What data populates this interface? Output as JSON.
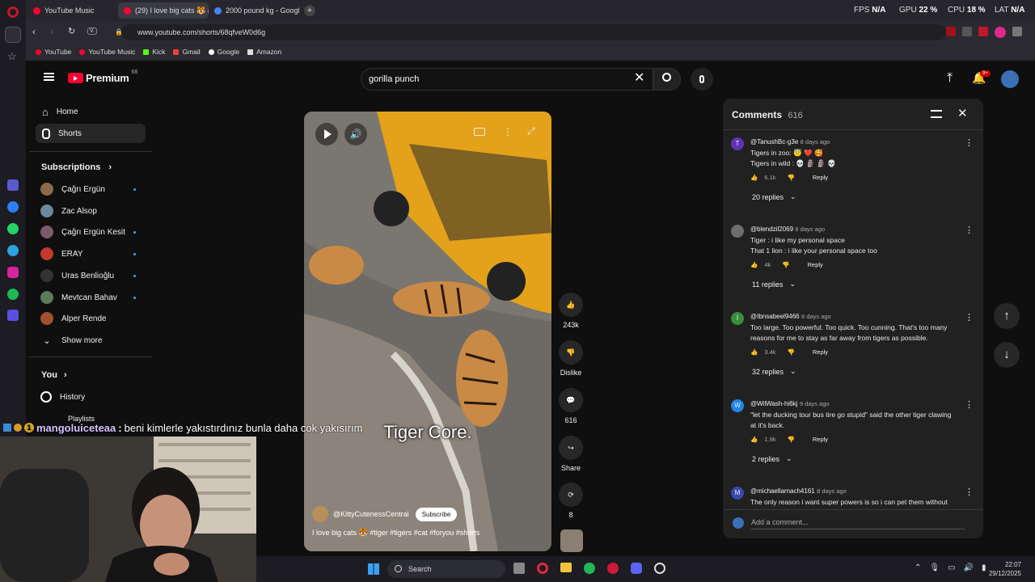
{
  "browser": {
    "tabs": [
      {
        "title": "YouTube Music",
        "color": "#ff0033"
      },
      {
        "title": "(29) I love big cats 🐯 #ti",
        "color": "#ff0033"
      },
      {
        "title": "2000 pound kg - Google'd",
        "color": "#4285f4"
      }
    ],
    "url_prefix": "V.",
    "url": "www.youtube.com/shorts/68qfveW0d6g",
    "bookmarks": [
      "YouTube",
      "YouTube Music",
      "Kick",
      "Gmail",
      "Google",
      "Amazon"
    ],
    "stats": {
      "fps_label": "FPS",
      "fps_value": "N/A",
      "gpu_label": "GPU",
      "gpu_value": "22 %",
      "cpu_label": "CPU",
      "cpu_value": "18 %",
      "lat_label": "LAT",
      "lat_value": "N/A"
    }
  },
  "yt": {
    "logo_text": "Premium",
    "logo_sup": "68",
    "search_value": "gorilla punch",
    "notif_badge": "9+",
    "sidebar": {
      "home": "Home",
      "shorts": "Shorts",
      "subscriptions_header": "Subscriptions",
      "subs": [
        {
          "name": "Çağrı Ergün",
          "live": true,
          "color": "#8a6a4a"
        },
        {
          "name": "Zac Alsop",
          "live": false,
          "color": "#6a8aa0"
        },
        {
          "name": "Çağrı Ergün Kesit",
          "live": true,
          "color": "#7a5a6a"
        },
        {
          "name": "ERAY",
          "live": true,
          "color": "#c0392b"
        },
        {
          "name": "Uras Benlioğlu",
          "live": true,
          "color": "#333"
        },
        {
          "name": "Mevtcan Bahav",
          "live": true,
          "color": "#5a7a5a"
        },
        {
          "name": "Alper Rende",
          "live": false,
          "color": "#a0522d"
        }
      ],
      "show_more": "Show more",
      "you_header": "You",
      "history": "History",
      "playlists": "Playlists"
    },
    "short": {
      "caption_overlay": "Tiger Core.",
      "channel": "@KittyCutenessCentral",
      "subscribe": "Subscribe",
      "title": "I love big cats 🐯 #tiger #tigers #cat #foryou #shorts",
      "likes": "243k",
      "dislike": "Dislike",
      "comments_count": "616",
      "share": "Share",
      "remix": "8"
    },
    "comments_panel": {
      "title": "Comments",
      "count": "616",
      "add_placeholder": "Add a comment...",
      "reply_label": "Reply",
      "items": [
        {
          "user": "@TanushBc-g3e",
          "time": "8 days ago",
          "text": "Tigers in zoo: 😇 ❤️ 🥰\nTigers in wild : 💀 🗿 🗿 💀",
          "likes": "6.1k",
          "replies": "20 replies",
          "avatar_letter": "T",
          "avatar_color": "#5e35b1"
        },
        {
          "user": "@blendzil2069",
          "time": "8 days ago",
          "text": "Tiger : i like my personal space\nThat 1 lion : i like your personal space too",
          "likes": "4k",
          "replies": "11 replies",
          "avatar_letter": "",
          "avatar_color": "#6d6d6d"
        },
        {
          "user": "@Ibnsabeel9466",
          "time": "8 days ago",
          "text": "Too large. Too powerful. Too quick. Too cunning. That's too many reasons for me to stay as far away from tigers as possible.",
          "likes": "3.4k",
          "replies": "32 replies",
          "avatar_letter": "I",
          "avatar_color": "#388e3c"
        },
        {
          "user": "@WilWash-hi6kj",
          "time": "9 days ago",
          "text": "\"let the ducking tour bus tire go stupid\" said the other tiger clawing at it's back.",
          "likes": "1.9k",
          "replies": "2 replies",
          "avatar_letter": "W",
          "avatar_color": "#1e88e5"
        },
        {
          "user": "@michaellarnach4161",
          "time": "8 days ago",
          "text": "The only reason i want super powers is so i can pet them without",
          "likes": "",
          "replies": "",
          "avatar_letter": "M",
          "avatar_color": "#3949ab"
        }
      ]
    }
  },
  "stream_chat": {
    "user": "mangoluiceteaa",
    "separator": ":",
    "message": "beni kimlerle yakıstırdınız bunla daha cok yakısırım",
    "badge": "1"
  },
  "taskbar": {
    "search": "Search",
    "time": "22:07",
    "date": "29/12/2025"
  }
}
